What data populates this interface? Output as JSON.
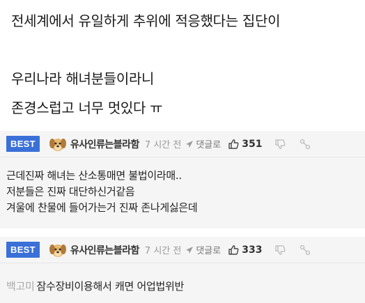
{
  "post": {
    "lines": [
      "전세계에서 유일하게 추위에 적응했다는 집단이",
      "우리나라 해녀분들이라니",
      "존경스럽고 너무 멋있다 ㅠ"
    ]
  },
  "comments": [
    {
      "badge": "BEST",
      "nickname": "유사인류는블라함",
      "time": "7 시간 전",
      "reply_label": "댓글로",
      "likes": "351",
      "text": [
        "근데진짜 해녀는 산소통매면 불법이라매..",
        "저분들은 진짜 대단하신거같음",
        "겨울에 찬물에 들어가는거 진짜 존나게싫은데"
      ]
    },
    {
      "badge": "BEST",
      "nickname": "유사인류는블라함",
      "time": "7 시간 전",
      "reply_label": "댓글로",
      "likes": "333",
      "tag": "백고미",
      "text": "잠수장비이용해서 캐면 어업법위반"
    }
  ],
  "icons": {
    "avatar": "dog-avatar-icon",
    "reply": "reply-arrow-icon",
    "like": "thumbs-up-icon",
    "dislike": "thumbs-down-icon",
    "share": "share-icon"
  },
  "colors": {
    "best_badge": "#3a70d8",
    "comment_bg": "#f5f5f5"
  }
}
